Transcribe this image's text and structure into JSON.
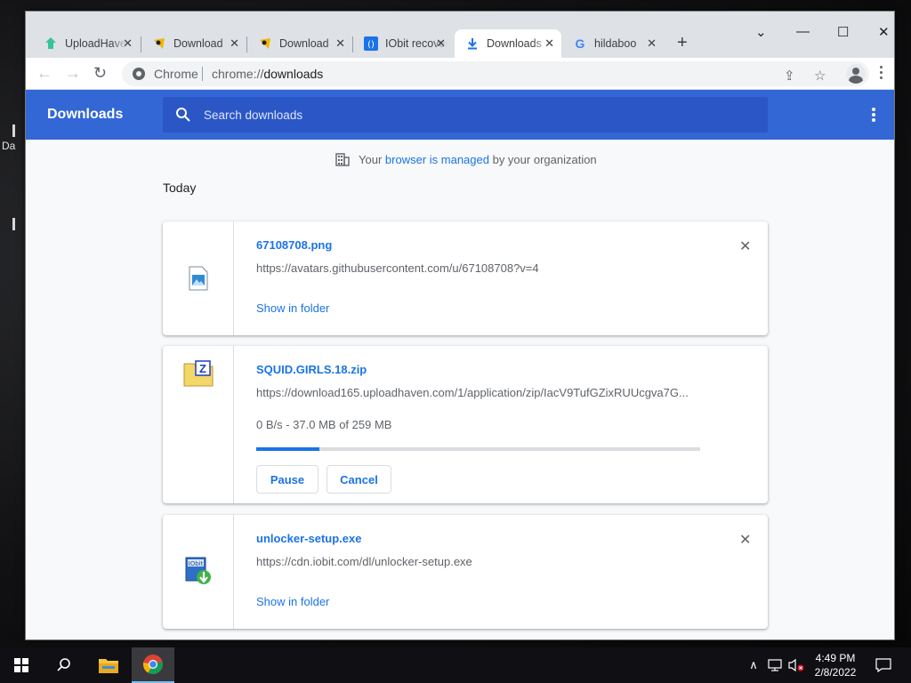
{
  "desktop": {
    "label": "Da"
  },
  "tabs": [
    {
      "title": "UploadHaven",
      "icon": "uploadhaven-icon",
      "active": false
    },
    {
      "title": "Download",
      "icon": "download-page-icon",
      "active": false
    },
    {
      "title": "Download",
      "icon": "download-page-icon",
      "active": false
    },
    {
      "title": "IObit recovery",
      "icon": "iobit-icon",
      "active": false
    },
    {
      "title": "Downloads",
      "icon": "download-arrow-icon",
      "active": true
    },
    {
      "title": "hildaboo",
      "icon": "google-icon",
      "active": false
    }
  ],
  "omnibox": {
    "site": "Chrome",
    "url_scheme": "chrome://",
    "url_path": "downloads"
  },
  "header": {
    "title": "Downloads",
    "search_placeholder": "Search downloads"
  },
  "managed": {
    "prefix": "Your",
    "link": "browser is managed",
    "suffix": "by your organization"
  },
  "section_label": "Today",
  "downloads": [
    {
      "filename": "67108708.png",
      "url": "https://avatars.githubusercontent.com/u/67108708?v=4",
      "action": "Show in folder",
      "icon": "image-file-icon"
    },
    {
      "filename": "SQUID.GIRLS.18.zip",
      "url": "https://download165.uploadhaven.com/1/application/zip/IacV9TufGZixRUUcgva7G...",
      "status": "0 B/s - 37.0 MB of 259 MB",
      "progress": 0.143,
      "pause_label": "Pause",
      "cancel_label": "Cancel",
      "icon": "zip-archive-icon"
    },
    {
      "filename": "unlocker-setup.exe",
      "url": "https://cdn.iobit.com/dl/unlocker-setup.exe",
      "action": "Show in folder",
      "icon": "installer-exe-icon"
    }
  ],
  "taskbar": {
    "time": "4:49 PM",
    "date": "2/8/2022"
  },
  "colors": {
    "header_blue": "#3367d6",
    "link_blue": "#1a73e8",
    "progress_track": "#dadce0"
  }
}
